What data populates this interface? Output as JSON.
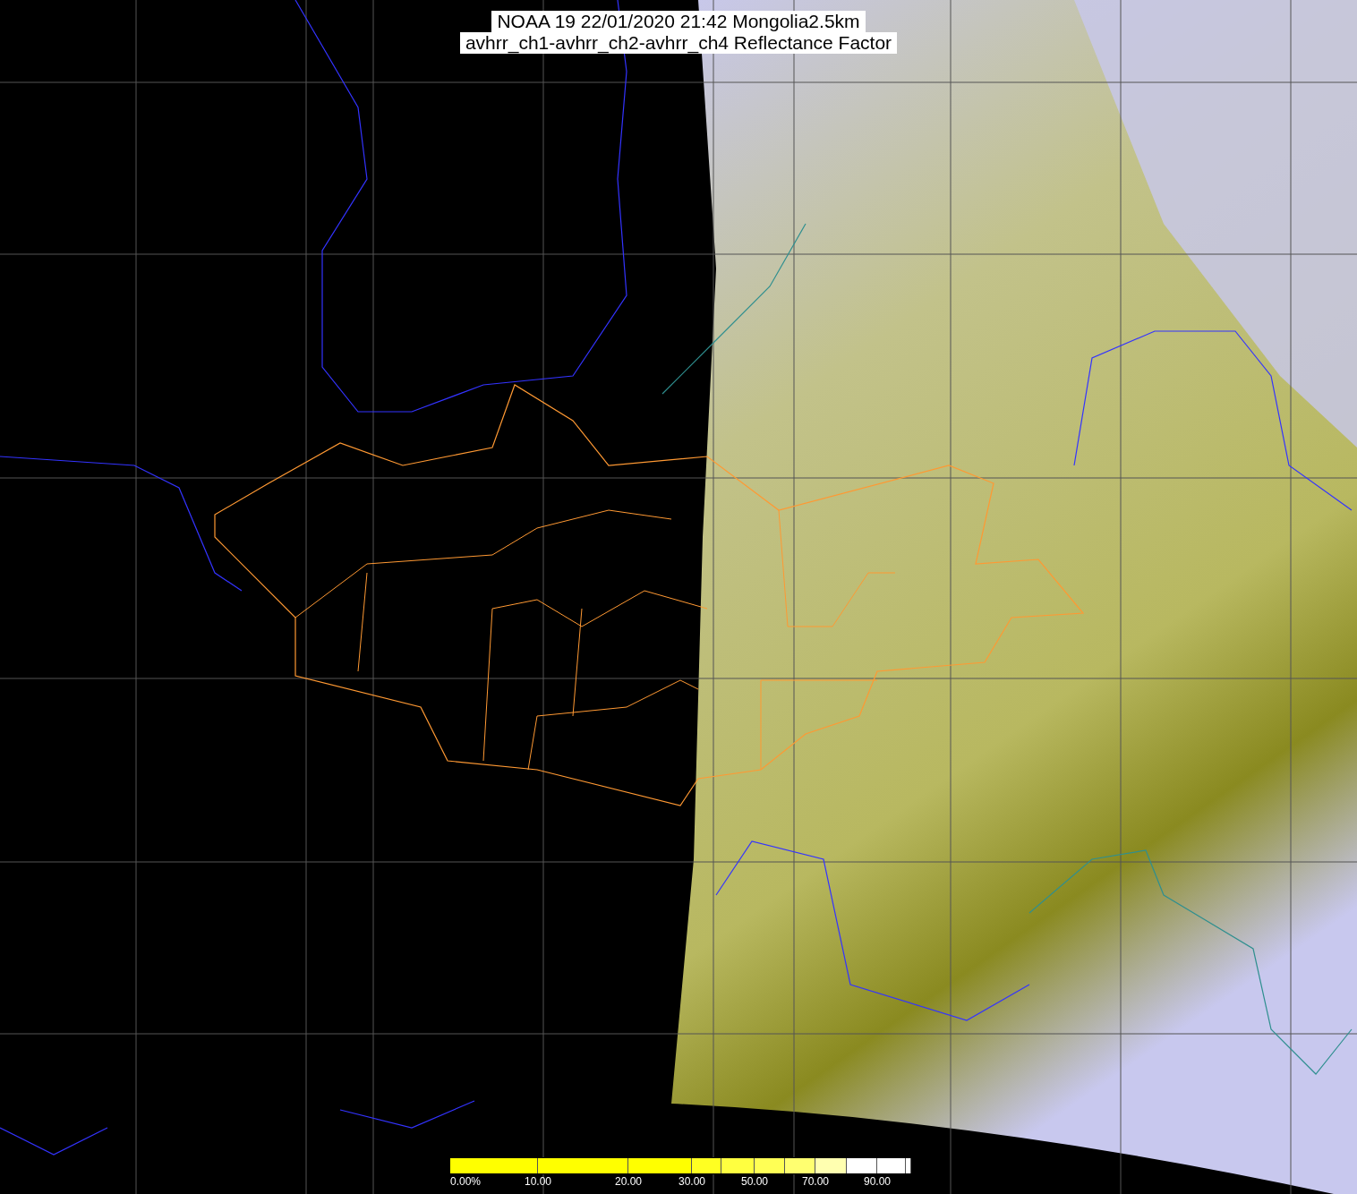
{
  "title": {
    "lines": [
      "NOAA 19 22/01/2020 21:42 Mongolia2.5km",
      "avhrr_ch1-avhrr_ch2-avhrr_ch4 Reflectance Factor"
    ]
  },
  "legend": {
    "segments": [
      {
        "color": "#ffff00",
        "label": "0.00%"
      },
      {
        "color": "#ffff00",
        "label": "10.00"
      },
      {
        "color": "#ffff00",
        "label": "20.00"
      },
      {
        "color": "#ffff22",
        "label": "30.00"
      },
      {
        "color": "#ffff40"
      },
      {
        "color": "#ffff55",
        "label": "50.00"
      },
      {
        "color": "#ffff70"
      },
      {
        "color": "#ffffb0",
        "label": "70.00"
      },
      {
        "color": "#ffffff"
      },
      {
        "color": "#ffffff",
        "label": "90.00"
      },
      {
        "color": "#ffffff"
      }
    ]
  }
}
